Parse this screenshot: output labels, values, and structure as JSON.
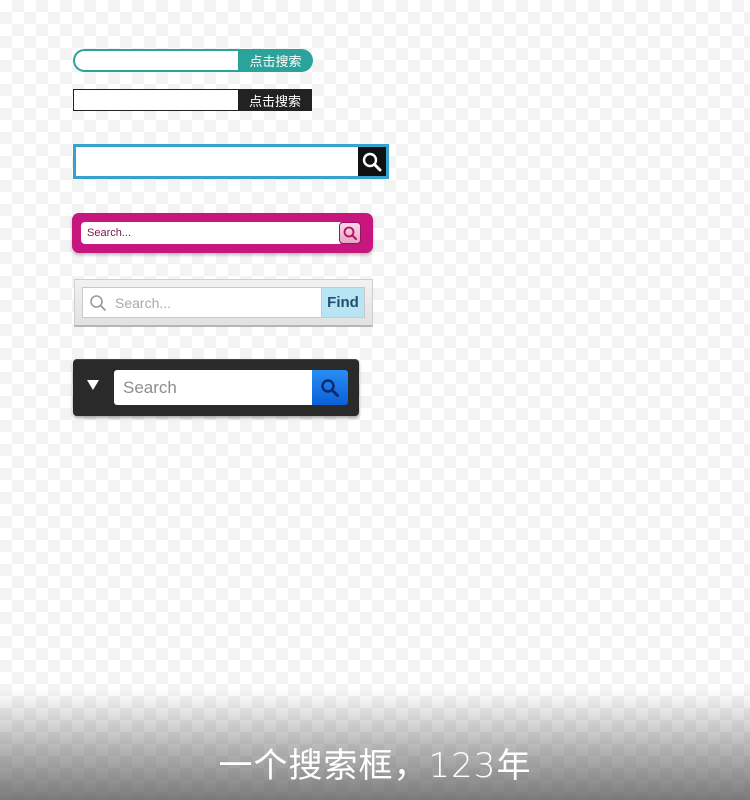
{
  "search_bars": [
    {
      "button_label": "点击搜索",
      "accent": "#2aa39a"
    },
    {
      "button_label": "点击搜索",
      "accent": "#222222"
    },
    {
      "button_icon": "search-icon",
      "accent": "#35a3cc"
    },
    {
      "placeholder": "Search...",
      "button_icon": "search-icon",
      "accent": "#c8167f"
    },
    {
      "placeholder": "Search...",
      "button_label": "Find",
      "input_icon": "search-icon",
      "accent": "#b9e4f3"
    },
    {
      "placeholder": "Search",
      "dropdown_icon": "triangle-down-icon",
      "button_icon": "search-icon",
      "accent": "#1a78ee"
    }
  ],
  "caption": "一个搜索框，123年"
}
